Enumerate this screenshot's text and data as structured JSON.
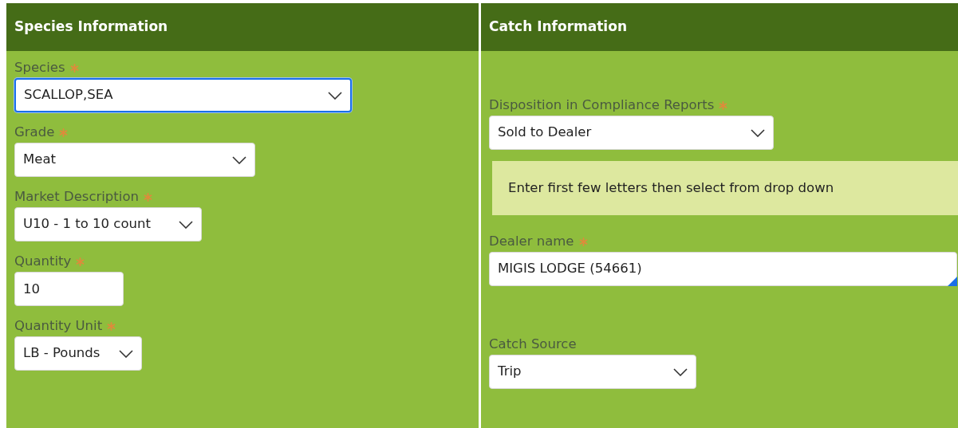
{
  "panels": [
    {
      "title": "Species Information",
      "fields": [
        {
          "label": "Species",
          "required": true,
          "kind": "select",
          "value": "SCALLOP,SEA",
          "focused": true
        },
        {
          "label": "Grade",
          "required": true,
          "kind": "select",
          "value": "Meat",
          "focused": false
        },
        {
          "label": "Market Description",
          "required": true,
          "kind": "select",
          "value": "U10 - 1 to 10 count",
          "focused": false
        },
        {
          "label": "Quantity",
          "required": true,
          "kind": "text",
          "value": "10",
          "focused": false
        },
        {
          "label": "Quantity Unit",
          "required": true,
          "kind": "select",
          "value": "LB - Pounds",
          "focused": false
        }
      ]
    },
    {
      "title": "Catch Information",
      "fields": [
        {
          "label": "Disposition in Compliance Reports",
          "required": true,
          "kind": "select",
          "value": "Sold to Dealer",
          "focused": false
        },
        {
          "kind": "hint",
          "text": "Enter first few letters then select from drop down"
        },
        {
          "label": "Dealer name",
          "required": true,
          "kind": "autocomplete",
          "value": "MIGIS LODGE (54661)",
          "focused": false
        },
        {
          "label": "Catch Source",
          "required": false,
          "kind": "select",
          "value": "Trip",
          "focused": false
        }
      ]
    }
  ]
}
